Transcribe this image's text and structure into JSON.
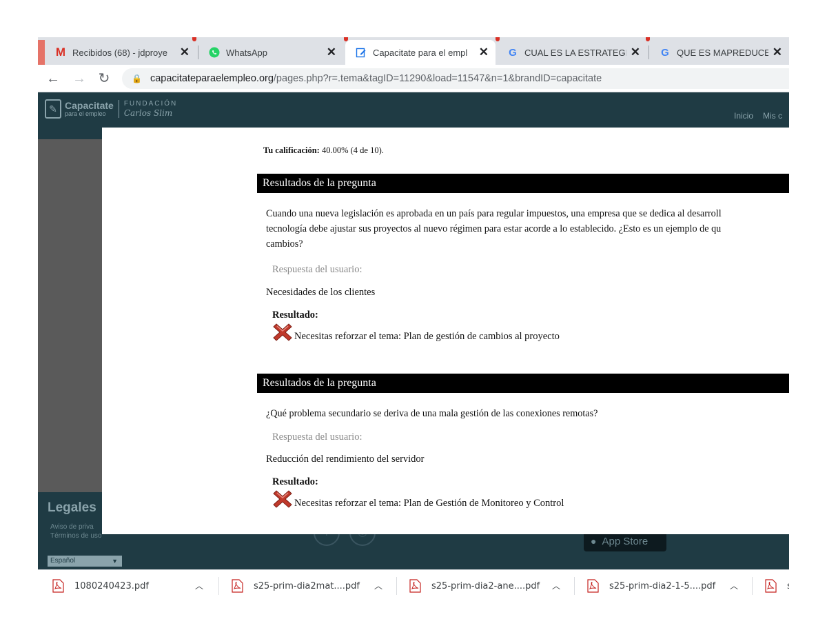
{
  "browser": {
    "tabs": [
      {
        "title": "Recibidos (68) - jdproye",
        "icon": "gmail-icon"
      },
      {
        "title": "WhatsApp",
        "icon": "whatsapp-icon"
      },
      {
        "title": "Capacitate para el empl",
        "icon": "edit-doc-icon"
      },
      {
        "title": "CUAL ES LA ESTRATEGIA",
        "icon": "google-icon"
      },
      {
        "title": "QUE ES MAPREDUCE - E",
        "icon": "google-icon"
      }
    ],
    "close_glyph": "✕",
    "url_host": "capacitateparaelempleo.org",
    "url_path": "/pages.php?r=.tema&tagID=11290&load=11547&n=1&brandID=capacitate"
  },
  "site": {
    "logo_title": "Capacitate",
    "logo_sub": "para el empleo",
    "logo_foundation_1": "FUNDACIÓN",
    "logo_foundation_2": "Carlos Slim",
    "nav": [
      "Inicio",
      "Mis c"
    ]
  },
  "quiz": {
    "score_label": "Tu calificación:",
    "score_value": "40.00% (4 de 10).",
    "questions": [
      {
        "header": "Resultados de la pregunta",
        "text_lines": [
          "Cuando una nueva legislación es aprobada en un país para regular impuestos, una empresa que se dedica al desarroll",
          "tecnología debe ajustar sus proyectos al nuevo régimen para estar acorde a lo establecido. ¿Esto es un ejemplo de qu",
          "cambios?"
        ],
        "user_label": "Respuesta del usuario:",
        "user_answer": "Necesidades de los clientes",
        "result_label": "Resultado:",
        "result_text": "Necesitas reforzar el tema: Plan de gestión de cambios al proyecto"
      },
      {
        "header": "Resultados de la pregunta",
        "text_lines": [
          "¿Qué problema secundario se deriva de una mala gestión de las conexiones remotas?"
        ],
        "user_label": "Respuesta del usuario:",
        "user_answer": "Reducción del rendimiento del servidor",
        "result_label": "Resultado:",
        "result_text": "Necesitas reforzar el tema: Plan de Gestión de Monitoreo y Control"
      }
    ]
  },
  "footer": {
    "legales": "Legales",
    "links": [
      "Aviso de priva",
      "Términos de uso"
    ],
    "language": "Español",
    "app_store": "App Store"
  },
  "downloads": [
    {
      "name": "1080240423.pdf"
    },
    {
      "name": "s25-prim-dia2mat....pdf"
    },
    {
      "name": "s25-prim-dia2-ane....pdf"
    },
    {
      "name": "s25-prim-dia2-1-5....pdf"
    },
    {
      "name": "s"
    }
  ],
  "colors": {
    "site_dark": "#1f3b44",
    "overlay": "#5a5a5a",
    "question_header": "#000000",
    "error_x": "#c0392b"
  }
}
